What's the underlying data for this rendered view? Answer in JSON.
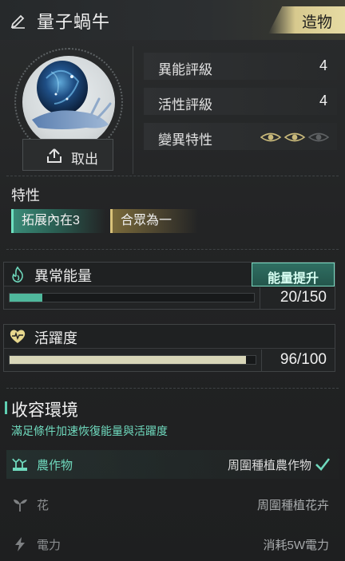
{
  "header": {
    "title": "量子蝸牛",
    "tag": "造物"
  },
  "portrait": {
    "extract_label": "取出"
  },
  "ratings": [
    {
      "label": "異能評級",
      "value": "4"
    },
    {
      "label": "活性評級",
      "value": "4"
    },
    {
      "label": "變異特性",
      "value": ""
    }
  ],
  "mutation_eyes": {
    "active": 2,
    "total": 3
  },
  "traits": {
    "title": "特性",
    "items": [
      {
        "label": "拓展內在3",
        "color": "#3a8b78"
      },
      {
        "label": "合眾為一",
        "color": "#7a6a3a"
      }
    ]
  },
  "energy": {
    "title": "異常能量",
    "boost_label": "能量提升",
    "current": 20,
    "max": 150,
    "value_text": "20/150",
    "fill_color": "#4fb89c"
  },
  "vitality": {
    "title": "活躍度",
    "current": 96,
    "max": 100,
    "value_text": "96/100",
    "fill_color": "#d8d6b8"
  },
  "environment": {
    "title": "收容環境",
    "description": "滿足條件加速恢復能量與活躍度",
    "items": [
      {
        "name": "農作物",
        "condition": "周圍種植農作物",
        "satisfied": true,
        "icon": "crop-icon"
      },
      {
        "name": "花",
        "condition": "周圍種植花卉",
        "satisfied": false,
        "icon": "sprout-icon"
      },
      {
        "name": "電力",
        "condition": "消耗5W電力",
        "satisfied": false,
        "icon": "lightning-icon"
      }
    ]
  },
  "colors": {
    "accent_teal": "#6fd9bd",
    "tag_gold": "#e6dba3"
  }
}
